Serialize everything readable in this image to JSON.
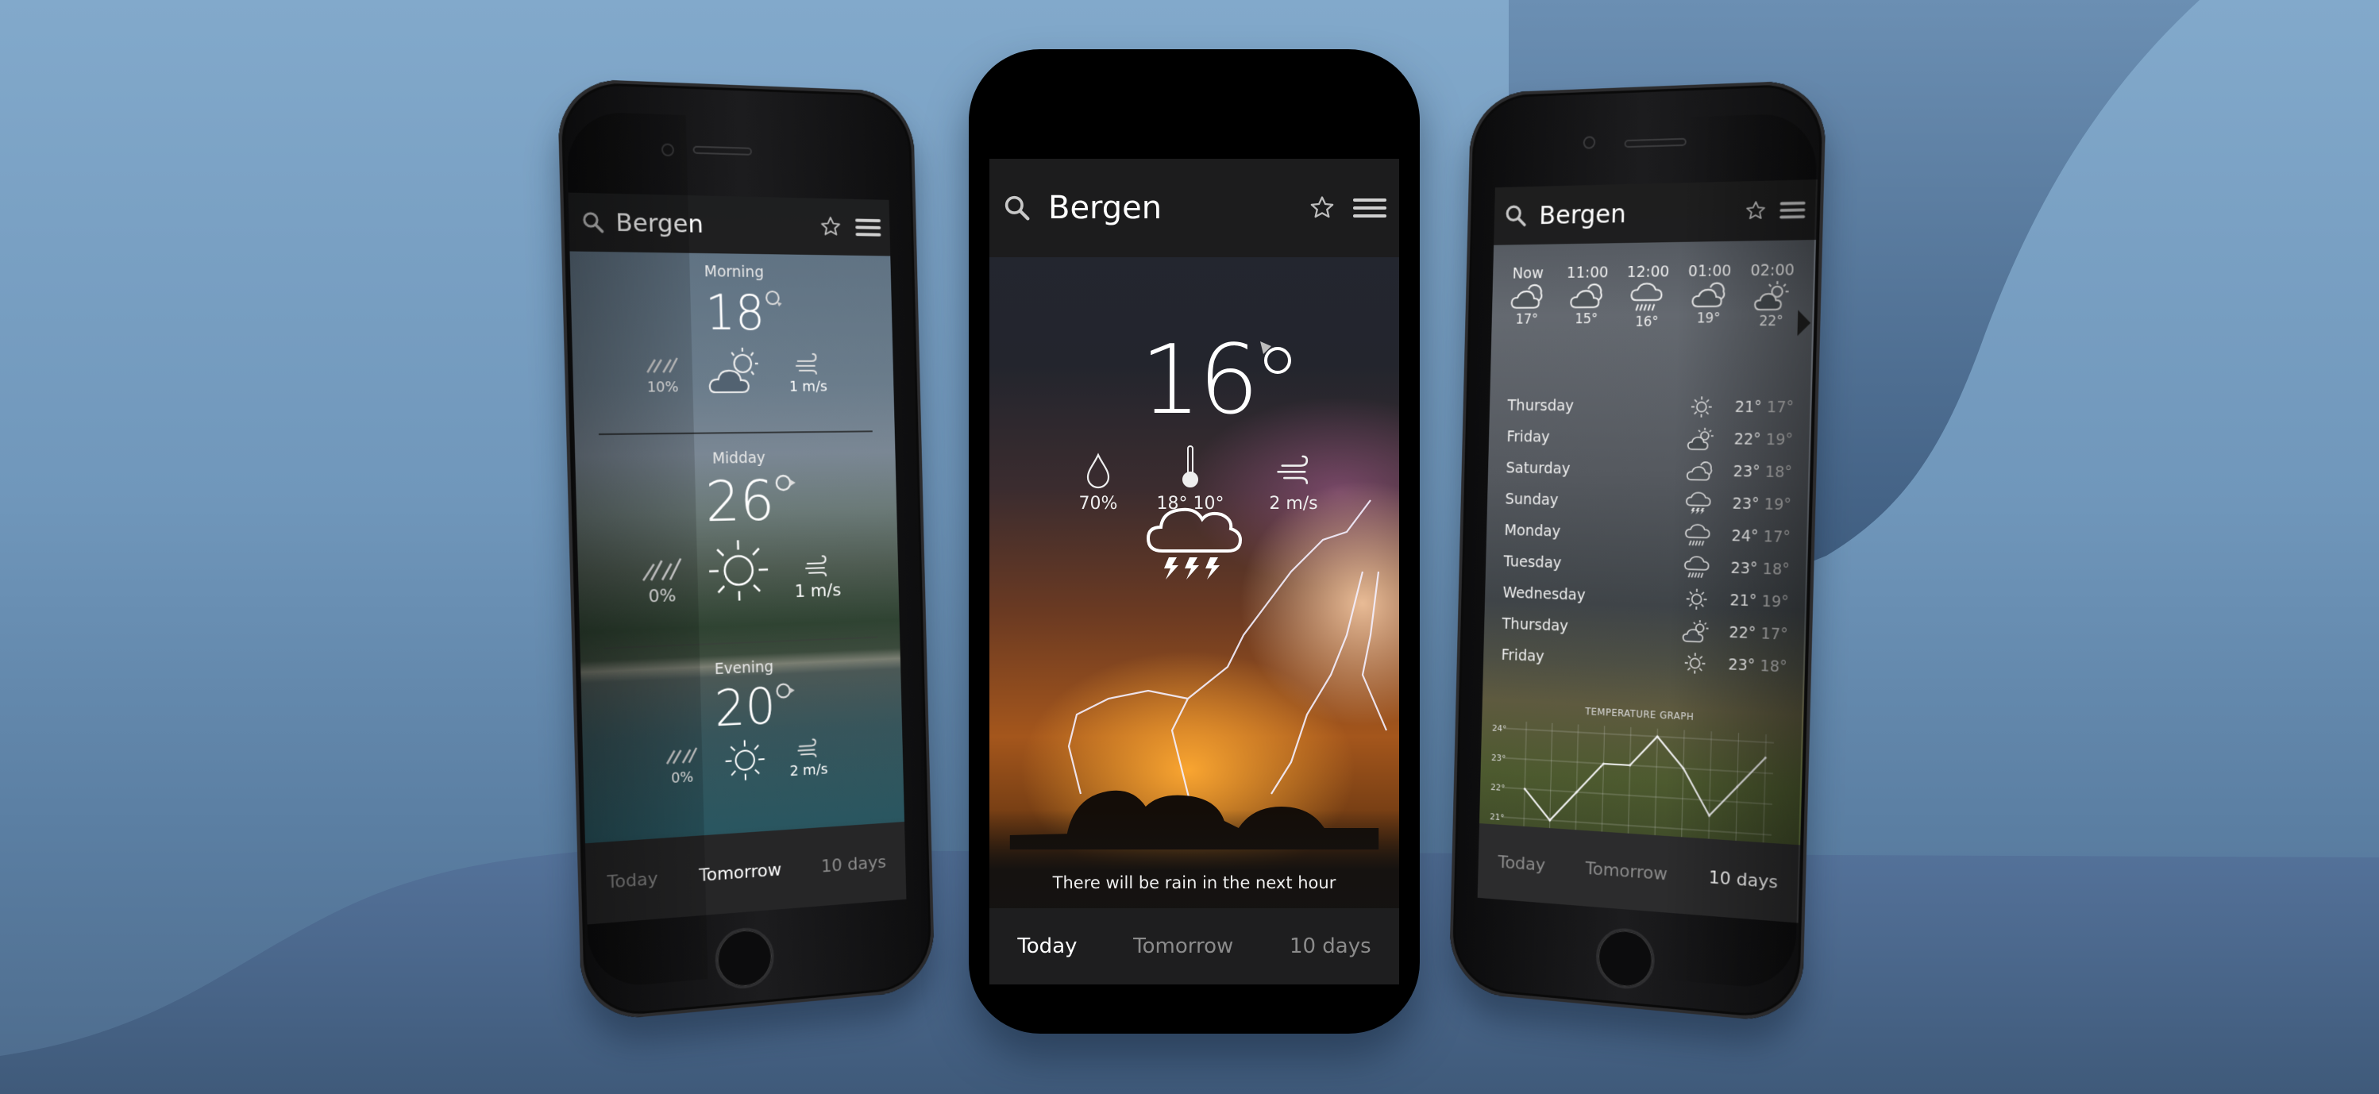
{
  "colors": {
    "accent_text": "#ffffff",
    "inactive_tab": "#8b8b8b",
    "appbar_bg": "#1c1c1c",
    "tabbar_bg": "#1e1e1f"
  },
  "phones": {
    "center": {
      "appbar": {
        "city": "Bergen",
        "icons": [
          "search-icon",
          "star-icon",
          "menu-icon"
        ]
      },
      "current": {
        "temperature": "16",
        "wind_direction_indicator": "degree-with-arrow",
        "humidity": "70%",
        "temp_range": "18° 10°",
        "wind": "2 m/s",
        "condition_icon": "thunderstorm-icon",
        "message": "There will be rain in the next hour"
      },
      "tabs": [
        {
          "label": "Today",
          "active": true
        },
        {
          "label": "Tomorrow",
          "active": false
        },
        {
          "label": "10 days",
          "active": false
        }
      ]
    },
    "left": {
      "appbar": {
        "city": "Bergen",
        "icons": [
          "search-icon",
          "star-icon",
          "menu-icon"
        ]
      },
      "periods": [
        {
          "label": "Morning",
          "temperature": "18",
          "precip": "10%",
          "condition_icon": "partly-cloudy-icon",
          "wind": "1 m/s"
        },
        {
          "label": "Midday",
          "temperature": "26",
          "precip": "0%",
          "condition_icon": "sun-icon",
          "wind": "1 m/s"
        },
        {
          "label": "Evening",
          "temperature": "20",
          "precip": "0%",
          "condition_icon": "sun-icon",
          "wind": "2 m/s"
        }
      ],
      "tabs": [
        {
          "label": "Today",
          "active": false
        },
        {
          "label": "Tomorrow",
          "active": true
        },
        {
          "label": "10 days",
          "active": false
        }
      ]
    },
    "right": {
      "appbar": {
        "city": "Bergen",
        "icons": [
          "search-icon",
          "star-icon",
          "menu-icon"
        ]
      },
      "hourly": [
        {
          "time": "Now",
          "icon": "cloudy-icon",
          "temp": "17°"
        },
        {
          "time": "11:00",
          "icon": "cloudy-icon",
          "temp": "15°"
        },
        {
          "time": "12:00",
          "icon": "rain-icon",
          "temp": "16°"
        },
        {
          "time": "01:00",
          "icon": "cloudy-icon",
          "temp": "19°"
        },
        {
          "time": "02:00",
          "icon": "partly-cloudy-icon",
          "temp": "22°"
        }
      ],
      "daily": [
        {
          "day": "Thursday",
          "icon": "sun-icon",
          "high": "21°",
          "low": "17°"
        },
        {
          "day": "Friday",
          "icon": "partly-cloudy-icon",
          "high": "22°",
          "low": "19°"
        },
        {
          "day": "Saturday",
          "icon": "cloudy-icon",
          "high": "23°",
          "low": "18°"
        },
        {
          "day": "Sunday",
          "icon": "thunderstorm-icon",
          "high": "23°",
          "low": "19°"
        },
        {
          "day": "Monday",
          "icon": "rain-icon",
          "high": "24°",
          "low": "17°"
        },
        {
          "day": "Tuesday",
          "icon": "rain-icon",
          "high": "23°",
          "low": "18°"
        },
        {
          "day": "Wednesday",
          "icon": "sun-icon",
          "high": "21°",
          "low": "19°"
        },
        {
          "day": "Thursday",
          "icon": "partly-cloudy-icon",
          "high": "22°",
          "low": "17°"
        },
        {
          "day": "Friday",
          "icon": "sun-icon",
          "high": "23°",
          "low": "18°"
        }
      ],
      "graph": {
        "title": "TEMPERATURE GRAPH",
        "y_ticks": [
          "24°",
          "23°",
          "22°",
          "21°"
        ],
        "y_range": [
          21,
          24
        ],
        "values": [
          22,
          21,
          22,
          23,
          23,
          24,
          23,
          21.5,
          22.5,
          23.5
        ]
      },
      "tabs": [
        {
          "label": "Today",
          "active": false
        },
        {
          "label": "Tomorrow",
          "active": false
        },
        {
          "label": "10 days",
          "active": true
        }
      ]
    }
  }
}
